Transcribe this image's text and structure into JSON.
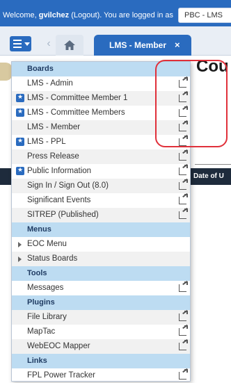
{
  "header": {
    "welcome_prefix": "Welcome, ",
    "username": "gvilchez",
    "logout_open": " (",
    "logout_label": "Logout",
    "logout_close": ").",
    "welcome_suffix": " You are logged in as",
    "position_value": "PBC - LMS"
  },
  "tabs": {
    "home_icon": "home-icon",
    "active_label": "LMS - Member",
    "close_glyph": "×"
  },
  "background": {
    "heading": "Cou",
    "table_column": "Date of U"
  },
  "menu": {
    "sections": [
      {
        "title": "Boards",
        "items": [
          {
            "label": "LMS - Admin",
            "starred": false,
            "external": true
          },
          {
            "label": "LMS - Committee Member 1",
            "starred": true,
            "external": true
          },
          {
            "label": "LMS - Committee Members",
            "starred": true,
            "external": true
          },
          {
            "label": "LMS - Member",
            "starred": false,
            "external": true
          },
          {
            "label": "LMS - PPL",
            "starred": true,
            "external": true
          },
          {
            "label": "Press Release",
            "starred": false,
            "external": true
          },
          {
            "label": "Public Information",
            "starred": true,
            "external": true
          },
          {
            "label": "Sign In / Sign Out (8.0)",
            "starred": false,
            "external": true
          },
          {
            "label": "Significant Events",
            "starred": false,
            "external": true
          },
          {
            "label": "SITREP (Published)",
            "starred": false,
            "external": true
          }
        ]
      },
      {
        "title": "Menus",
        "items": [
          {
            "label": "EOC Menu",
            "expandable": true
          },
          {
            "label": "Status Boards",
            "expandable": true
          }
        ]
      },
      {
        "title": "Tools",
        "items": [
          {
            "label": "Messages",
            "external": true
          }
        ]
      },
      {
        "title": "Plugins",
        "items": [
          {
            "label": "File Library",
            "external": true
          },
          {
            "label": "MapTac",
            "external": true
          },
          {
            "label": "WebEOC Mapper",
            "external": true
          }
        ]
      },
      {
        "title": "Links",
        "items": [
          {
            "label": "FPL Power Tracker",
            "external": true
          }
        ]
      }
    ]
  },
  "colors": {
    "brand": "#2a6bbf",
    "section_header": "#bddcf2",
    "highlight": "#e0303a"
  }
}
